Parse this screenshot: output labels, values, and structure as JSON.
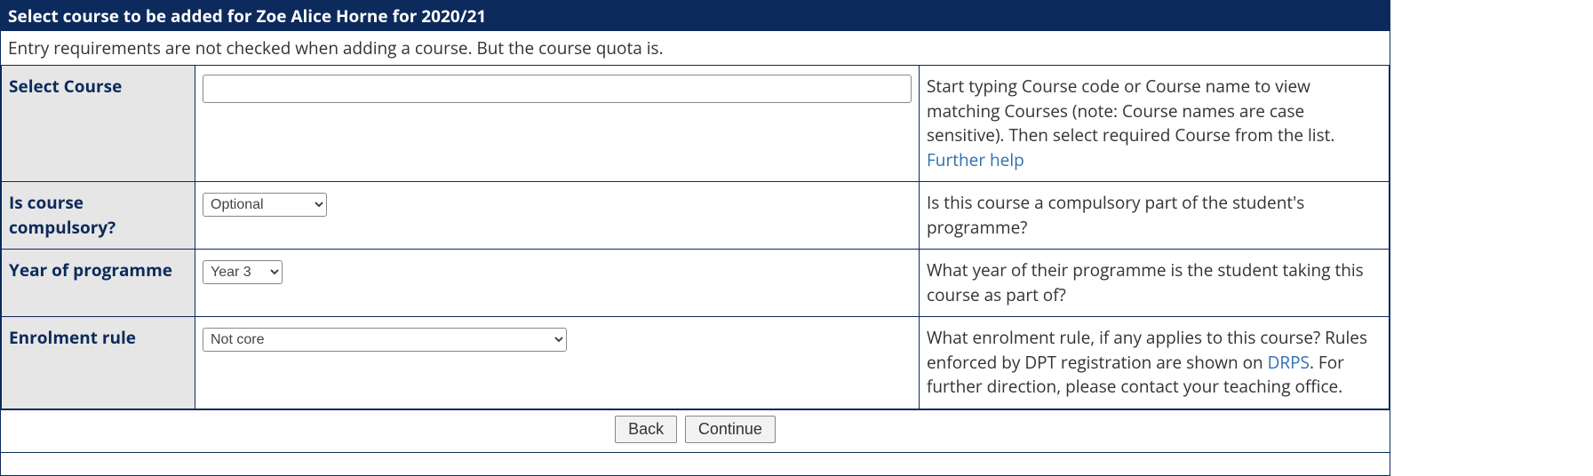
{
  "header": {
    "title": "Select course to be added for Zoe Alice Horne for 2020/21"
  },
  "intro_text": "Entry requirements are not checked when adding a course. But the course quota is.",
  "rows": {
    "select_course": {
      "label": "Select Course",
      "value": "",
      "help_pre": "Start typing Course code or Course name to view matching Courses (note: Course names are case sensitive). Then select required Course from the list. ",
      "help_link_text": "Further help"
    },
    "compulsory": {
      "label": "Is course compulsory?",
      "selected": "Optional",
      "help": "Is this course a compulsory part of the student's programme?"
    },
    "year": {
      "label": "Year of programme",
      "selected": "Year 3",
      "help": "What year of their programme is the student taking this course as part of?"
    },
    "enrolment": {
      "label": "Enrolment rule",
      "selected": "Not core",
      "help_pre": "What enrolment rule, if any applies to this course? Rules enforced by DPT registration are shown on ",
      "help_link_text": "DRPS",
      "help_post": ". For further direction, please contact your teaching office."
    }
  },
  "buttons": {
    "back": "Back",
    "continue": "Continue"
  }
}
